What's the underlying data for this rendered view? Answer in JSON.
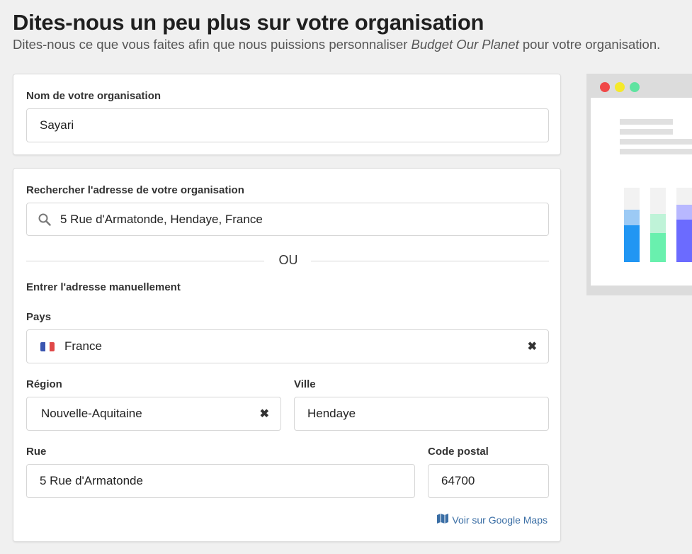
{
  "header": {
    "title": "Dites-nous un peu plus sur votre organisation",
    "subtitle_before": "Dites-nous ce que vous faites afin que nous puissions personnaliser ",
    "subtitle_brand": "Budget Our Planet",
    "subtitle_after": " pour votre organisation."
  },
  "org": {
    "label": "Nom de votre organisation",
    "value": "Sayari"
  },
  "address": {
    "search_label": "Rechercher l'adresse de votre organisation",
    "search_value": "5 Rue d'Armatonde, Hendaye, France",
    "or_text": "OU",
    "manual_label": "Entrer l'adresse manuellement",
    "country_label": "Pays",
    "country_value": "France",
    "region_label": "Région",
    "region_value": "Nouvelle-Aquitaine",
    "city_label": "Ville",
    "city_value": "Hendaye",
    "street_label": "Rue",
    "street_value": "5 Rue d'Armatonde",
    "postal_label": "Code postal",
    "postal_value": "64700",
    "clear_glyph": "✖",
    "map_link": "Voir sur Google Maps"
  },
  "icons": {
    "search": "search-icon",
    "flag": "france-flag-icon",
    "map": "map-icon"
  },
  "colors": {
    "link": "#3a6ea5",
    "dot_red": "#f04848",
    "dot_yellow": "#f5e92a",
    "dot_green": "#5fe3a0",
    "bar_blue": "#2196f3",
    "bar_green": "#69f0ae",
    "bar_purple": "#6b6bff"
  }
}
